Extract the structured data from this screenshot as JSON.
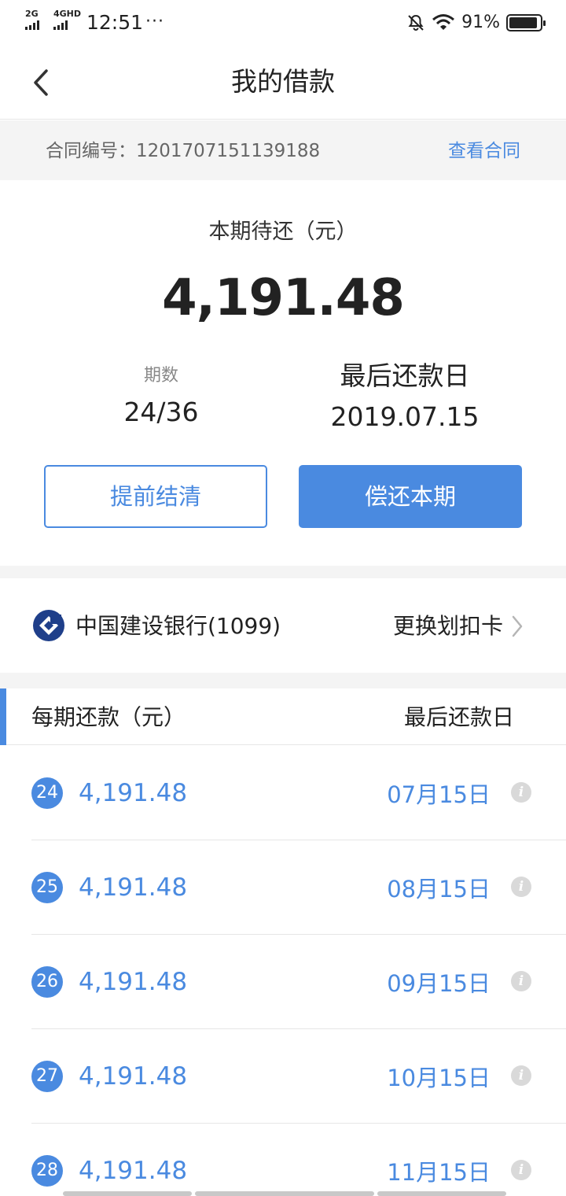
{
  "status_bar": {
    "sig1_label": "2G",
    "sig2_label": "4GHD",
    "time": "12:51",
    "dots": "···",
    "battery": "91%",
    "battery_level": 0.91
  },
  "header": {
    "title": "我的借款"
  },
  "contract": {
    "label": "合同编号：1201707151139188",
    "link": "查看合同"
  },
  "summary": {
    "due_label": "本期待还（元）",
    "due_amount": "4,191.48",
    "period_label": "期数",
    "period_value": "24/36",
    "last_day_label": "最后还款日",
    "last_day_value": "2019.07.15",
    "settle_button": "提前结清",
    "repay_button": "偿还本期"
  },
  "bank": {
    "name": "中国建设银行(1099)",
    "change_label": "更换划扣卡"
  },
  "schedule": {
    "col_amount": "每期还款（元）",
    "col_date": "最后还款日",
    "info_glyph": "i",
    "rows": [
      {
        "num": "24",
        "amount": "4,191.48",
        "date": "07月15日"
      },
      {
        "num": "25",
        "amount": "4,191.48",
        "date": "08月15日"
      },
      {
        "num": "26",
        "amount": "4,191.48",
        "date": "09月15日"
      },
      {
        "num": "27",
        "amount": "4,191.48",
        "date": "10月15日"
      },
      {
        "num": "28",
        "amount": "4,191.48",
        "date": "11月15日"
      }
    ]
  },
  "colors": {
    "accent": "#4a8ae0",
    "bank_logo": "#1f3f8a"
  }
}
